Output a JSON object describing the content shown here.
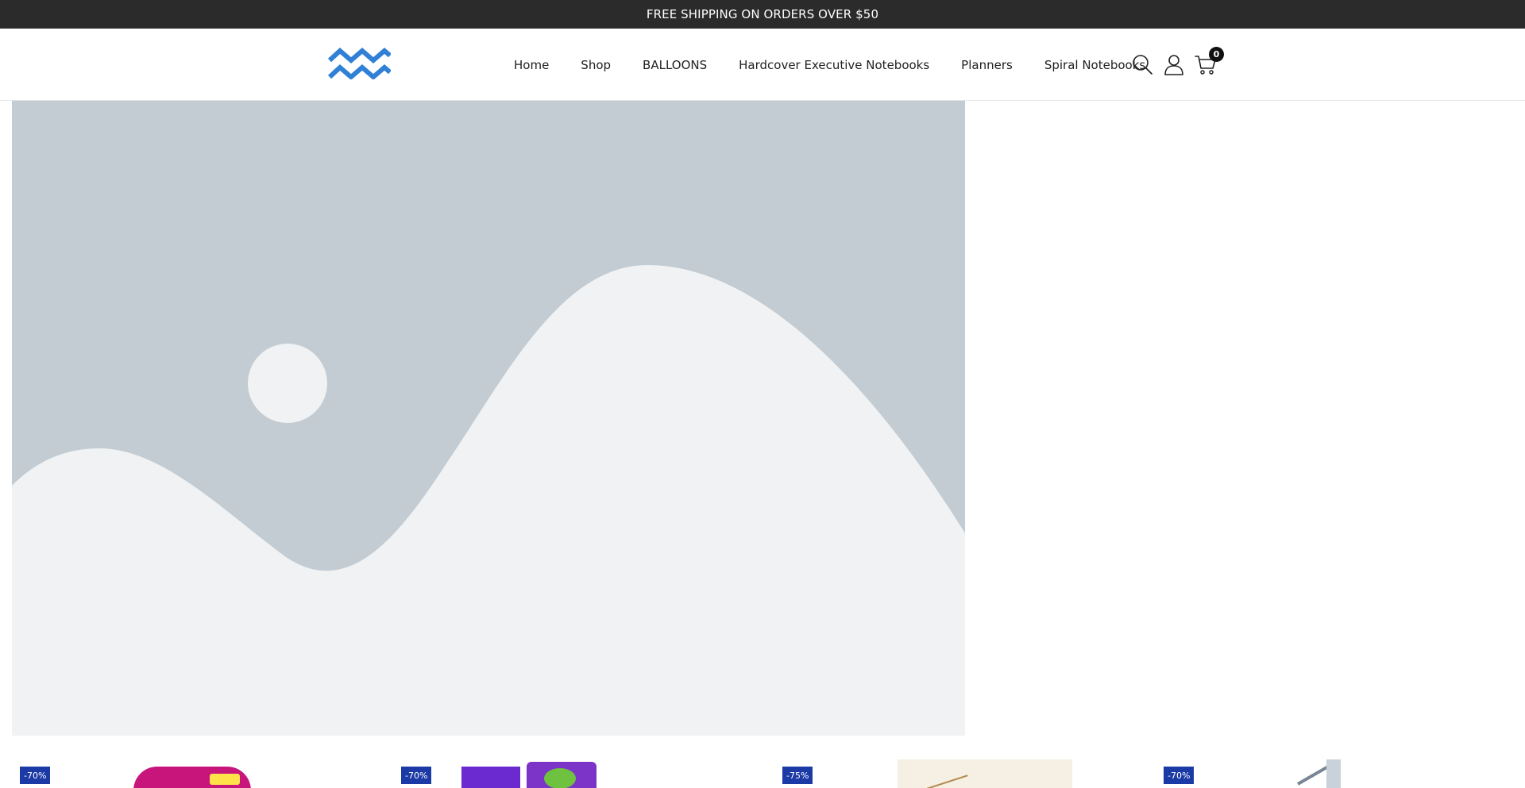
{
  "announcement": {
    "text": "FREE SHIPPING ON ORDERS OVER $50"
  },
  "header": {
    "logo_icon": "zigzag-logo-icon",
    "nav": [
      {
        "label": "Home"
      },
      {
        "label": "Shop"
      },
      {
        "label": "BALLOONS"
      },
      {
        "label": "Hardcover Executive Notebooks"
      },
      {
        "label": "Planners"
      },
      {
        "label": "Spiral Notebooks"
      }
    ],
    "icons": [
      "search-icon",
      "account-icon",
      "cart-icon"
    ],
    "cart_count": "0"
  },
  "hero": {
    "image": "placeholder-landscape-icon"
  },
  "products": [
    {
      "badge": "-70%"
    },
    {
      "badge": "-70%"
    },
    {
      "badge": "-75%"
    },
    {
      "badge": "-70%"
    }
  ],
  "colors": {
    "announcement_bg": "#2b2b2b",
    "logo_blue": "#2f80d6",
    "placeholder_bg": "#c3ccd3",
    "placeholder_fg": "#f0f2f3",
    "badge_bg": "#1b3aa6"
  }
}
